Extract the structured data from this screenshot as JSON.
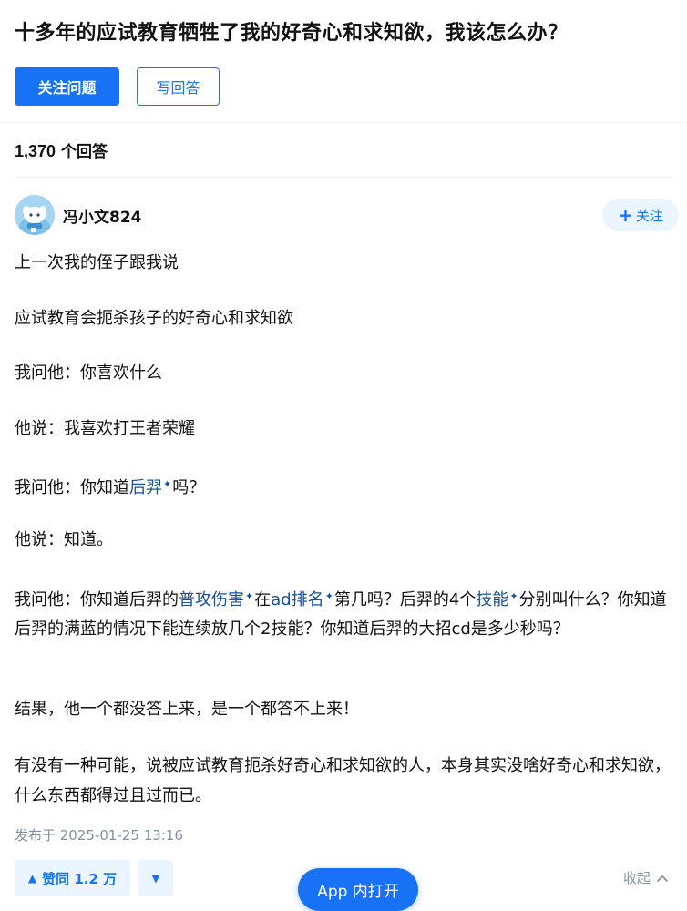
{
  "question": {
    "title": "十多年的应试教育牺牲了我的好奇心和求知欲，我该怎么办？",
    "follow_label": "关注问题",
    "write_label": "写回答"
  },
  "answers_header": {
    "count": "1,370",
    "suffix": " 个回答"
  },
  "author": {
    "name": "冯小文824",
    "follow_label": "关注"
  },
  "content": {
    "p1": "上一次我的侄子跟我说",
    "p2": "应试教育会扼杀孩子的好奇心和求知欲",
    "p3": "我问他：你喜欢什么",
    "p4": "他说：我喜欢打王者荣耀",
    "p5_a": "我问他：你知道",
    "p5_kw": "后羿",
    "p5_b": "吗？",
    "p6": "他说：知道。",
    "p7_a": "我问他：你知道后羿的",
    "p7_kw1": "普攻伤害",
    "p7_b": "在",
    "p7_kw2": "ad排名",
    "p7_c": "第几吗？后羿的4个",
    "p7_kw3": "技能",
    "p7_d": "分别叫什么？你知道后羿的满蓝的情况下能连续放几个2技能？你知道后羿的大招cd是多少秒吗？",
    "p8": "结果，他一个都没答上来，是一个都答不上来！",
    "p9": "有没有一种可能，说被应试教育扼杀好奇心和求知欲的人，本身其实没啥好奇心和求知欲，什么东西都得过且过而已。",
    "sparkle": "✦"
  },
  "meta": {
    "publish_time": "发布于 2025-01-25 13:16"
  },
  "actions": {
    "vote_up_label": "赞同 1.2 万",
    "open_app_label": "App 内打开",
    "collapse_label": "收起"
  },
  "colors": {
    "accent": "#1772f6",
    "link": "#175199",
    "muted": "#8491a5",
    "light_bg": "#ebf5ff"
  }
}
